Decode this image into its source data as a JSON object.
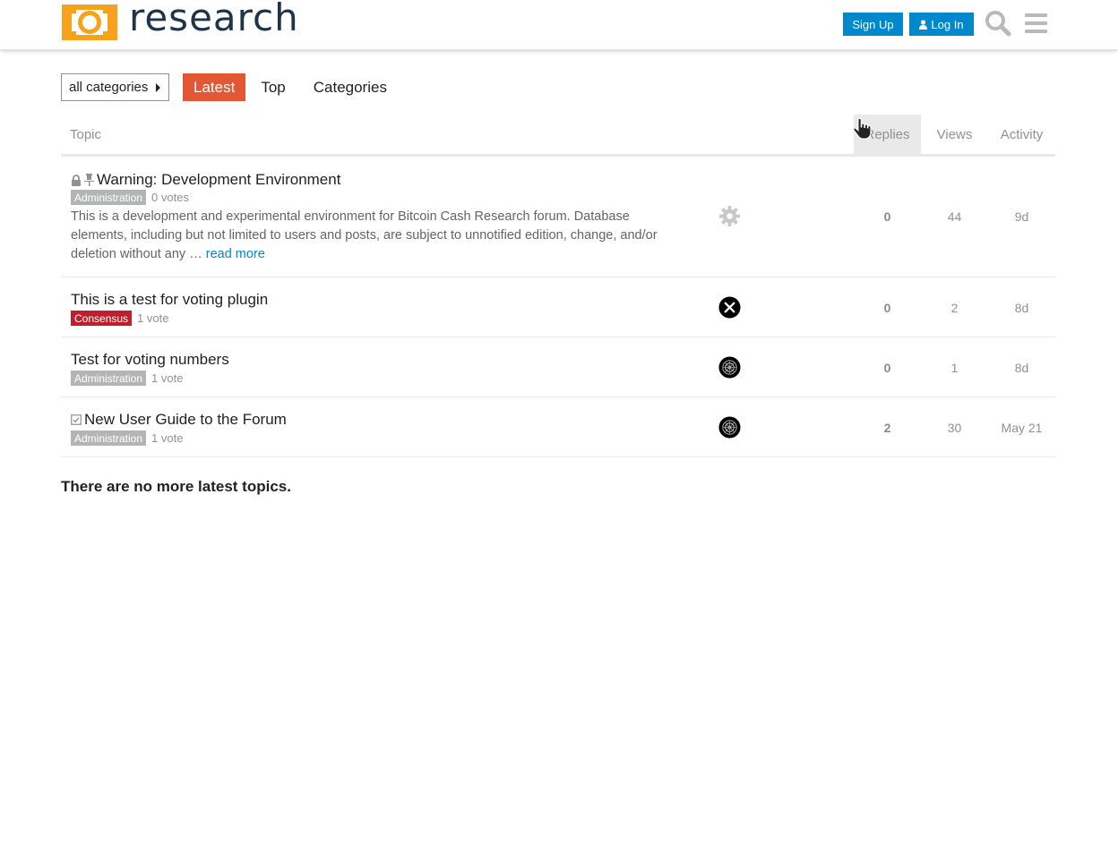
{
  "header": {
    "logo_text": "research",
    "signup_label": "Sign Up",
    "login_label": "Log In"
  },
  "nav": {
    "category_dropdown": "all categories",
    "tabs": [
      {
        "label": "Latest",
        "active": true
      },
      {
        "label": "Top",
        "active": false
      },
      {
        "label": "Categories",
        "active": false
      }
    ]
  },
  "table": {
    "columns": {
      "topic": "Topic",
      "replies": "Replies",
      "views": "Views",
      "activity": "Activity"
    },
    "topics": [
      {
        "title": "Warning: Development Environment",
        "status_icons": [
          "lock-icon",
          "pin-icon"
        ],
        "category": "Administration",
        "votes": "0 votes",
        "excerpt": "This is a development and experimental environment for Bitcoin Cash Research forum. Database elements, including but not limited to users and posts, are subject to unnotified edition, change, and/or deletion without any …",
        "read_more": "read more",
        "poster_avatar": "gear-avatar-icon",
        "replies": "0",
        "views": "44",
        "activity": "9d"
      },
      {
        "title": "This is a test for voting plugin",
        "category": "Consensus",
        "votes": "1 vote",
        "poster_avatar": "x-avatar-icon",
        "replies": "0",
        "views": "2",
        "activity": "8d"
      },
      {
        "title": "Test for voting numbers",
        "category": "Administration",
        "votes": "1 vote",
        "poster_avatar": "mandala-avatar-icon",
        "replies": "0",
        "views": "1",
        "activity": "8d"
      },
      {
        "title": "New User Guide to the Forum",
        "status_icons": [
          "checkbox-icon"
        ],
        "category": "Administration",
        "votes": "1 vote",
        "poster_avatar": "mandala-avatar-icon",
        "replies": "2",
        "views": "30",
        "activity": "May 21"
      }
    ]
  },
  "footer": {
    "message": "There are no more latest topics."
  },
  "colors": {
    "brand_orange": "#f7a21b",
    "primary_blue": "#0088cc",
    "latest_tab": "#e45735",
    "administration_badge": "#b3b5b4",
    "consensus_badge": "#bf1e2e"
  }
}
